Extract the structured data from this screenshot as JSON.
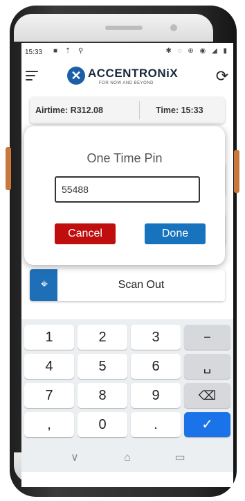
{
  "status_bar": {
    "time": "15:33",
    "notification_icons": "■ ⇡ ⚲",
    "system_icons": "✱ ◌ ⊕ ◉ ◢ ▮"
  },
  "app_bar": {
    "logo_text": "ACCENTRONiX",
    "logo_tagline": "FOR NOW AND BEYOND",
    "menu_icon": "hamburger-icon",
    "refresh_icon": "refresh-icon"
  },
  "info_bar": {
    "airtime": "Airtime: R312.08",
    "time": "Time: 15:33"
  },
  "dialog": {
    "title": "One Time Pin",
    "pin_value": "55488",
    "cancel_label": "Cancel",
    "done_label": "Done"
  },
  "scan_card": {
    "label": "Scan Out"
  },
  "keyboard": {
    "keys": [
      "1",
      "2",
      "3",
      "−",
      "4",
      "5",
      "6",
      "␣",
      "7",
      "8",
      "9",
      "⌫",
      ",",
      "0",
      ".",
      "✓"
    ]
  },
  "nav_bar": {
    "back": "∨",
    "home": "⌂",
    "recents": "▭"
  },
  "colors": {
    "cancel": "#c00d0d",
    "done": "#1773bd",
    "accent_blue": "#1f6fb8",
    "enter_key": "#1a73e8"
  }
}
